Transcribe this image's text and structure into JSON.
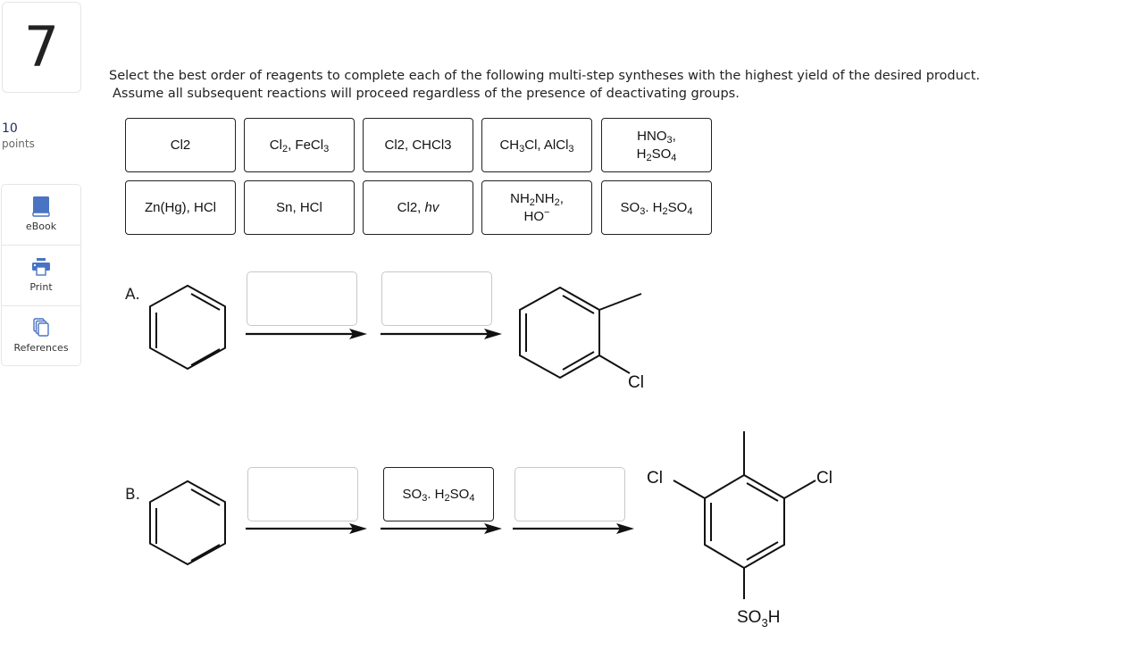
{
  "question": {
    "number": "7",
    "points_value": "10",
    "points_label": "points",
    "instructions_line1": "Select the best order of reagents to complete each of the following multi-step syntheses with the highest yield of the desired product.",
    "instructions_line2": "Assume all subsequent reactions will proceed regardless of the presence of deactivating groups."
  },
  "tools": [
    {
      "label": "eBook",
      "icon": "book-icon"
    },
    {
      "label": "Print",
      "icon": "printer-icon"
    },
    {
      "label": "References",
      "icon": "documents-icon"
    }
  ],
  "reagent_bank": [
    {
      "id": "cl2",
      "parts": [
        [
          "t",
          "Cl2"
        ]
      ]
    },
    {
      "id": "cl2-fecl3",
      "parts": [
        [
          "t",
          "Cl"
        ],
        [
          "sub",
          "2"
        ],
        [
          "t",
          ", FeCl"
        ],
        [
          "sub",
          "3"
        ]
      ]
    },
    {
      "id": "cl2-chcl3",
      "parts": [
        [
          "t",
          "Cl2, CHCl3"
        ]
      ]
    },
    {
      "id": "ch3cl-alcl3",
      "parts": [
        [
          "t",
          "CH"
        ],
        [
          "sub",
          "3"
        ],
        [
          "t",
          "Cl, AlCl"
        ],
        [
          "sub",
          "3"
        ]
      ]
    },
    {
      "id": "hno3-h2so4",
      "parts": [
        [
          "t",
          "HNO"
        ],
        [
          "sub",
          "3"
        ],
        [
          "t",
          ","
        ],
        [
          "br",
          ""
        ],
        [
          "t",
          "H"
        ],
        [
          "sub",
          "2"
        ],
        [
          "t",
          "SO"
        ],
        [
          "sub",
          "4"
        ]
      ]
    },
    {
      "id": "zn-hg-hcl",
      "parts": [
        [
          "t",
          "Zn(Hg), HCl"
        ]
      ]
    },
    {
      "id": "sn-hcl",
      "parts": [
        [
          "t",
          "Sn, HCl"
        ]
      ]
    },
    {
      "id": "cl2-hv",
      "parts": [
        [
          "t",
          "Cl2, "
        ],
        [
          "i",
          "hv"
        ]
      ]
    },
    {
      "id": "nh2nh2-ho",
      "parts": [
        [
          "t",
          "NH"
        ],
        [
          "sub",
          "2"
        ],
        [
          "t",
          "NH"
        ],
        [
          "sub",
          "2"
        ],
        [
          "t",
          ","
        ],
        [
          "br",
          ""
        ],
        [
          "t",
          "HO"
        ],
        [
          "sup",
          "−"
        ]
      ]
    },
    {
      "id": "so3-h2so4",
      "parts": [
        [
          "t",
          "SO"
        ],
        [
          "sub",
          "3"
        ],
        [
          "t",
          ". H"
        ],
        [
          "sub",
          "2"
        ],
        [
          "t",
          "SO"
        ],
        [
          "sub",
          "4"
        ]
      ]
    }
  ],
  "syntheses": [
    {
      "label": "A.",
      "start": "benzene",
      "slots": [
        null,
        null
      ],
      "product": {
        "name": "2-chlorotoluene",
        "substituent_labels": [
          "Cl"
        ]
      }
    },
    {
      "label": "B.",
      "start": "benzene",
      "slots": [
        null,
        {
          "id": "so3-h2so4",
          "parts": [
            [
              "t",
              "SO"
            ],
            [
              "sub",
              "3"
            ],
            [
              "t",
              ". H"
            ],
            [
              "sub",
              "2"
            ],
            [
              "t",
              "SO"
            ],
            [
              "sub",
              "4"
            ]
          ]
        },
        null
      ],
      "product": {
        "name": "3,5-dichloro-4-methylbenzenesulfonic acid",
        "substituent_labels": [
          "Cl",
          "Cl",
          "SO3H"
        ]
      }
    }
  ]
}
